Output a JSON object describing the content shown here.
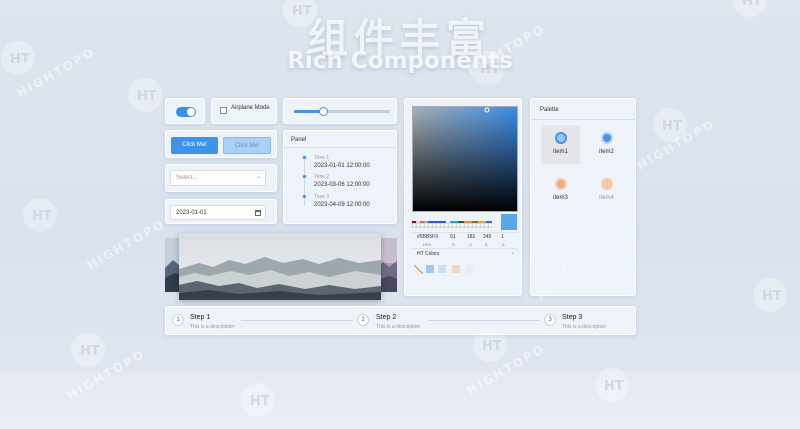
{
  "header": {
    "title_cn": "组件丰富",
    "title_en": "Rich Components"
  },
  "watermark": {
    "text": "HIGHTOPO",
    "logo_text": "HT"
  },
  "switch": {
    "on": true
  },
  "airplane_mode": {
    "label": "Airplane Mode",
    "checked": false
  },
  "slider": {
    "value": 0.3
  },
  "buttons": {
    "primary_label": "Click Me!",
    "secondary_label": "Click Me!"
  },
  "select": {
    "placeholder": "Select...",
    "chevron": "⌄"
  },
  "date_picker": {
    "value": "2023-01-01"
  },
  "panel": {
    "title": "Panel",
    "items": [
      {
        "label": "Time 1",
        "time": "2023-01-01 12:00:00"
      },
      {
        "label": "Time 2",
        "time": "2023-03-06 12:00:00"
      },
      {
        "label": "Time 3",
        "time": "2023-04-09 12:00:00"
      }
    ]
  },
  "color_picker": {
    "hex": "#5BB5F9",
    "r": "91",
    "g": "181",
    "b": "249",
    "a": "1",
    "hex_label": "HEX",
    "r_label": "R",
    "g_label": "G",
    "b_label": "B",
    "a_label": "A",
    "preset_label": "HT Colors",
    "chevron": "⌄",
    "swatches": [
      "#9fcaf0",
      "#c9def2",
      "#f0d7c8",
      "#e8ebf0",
      "#f2f3f5"
    ]
  },
  "palette": {
    "title": "Palette",
    "items": [
      {
        "label": "item1",
        "color": "#4a90e2",
        "selected": true
      },
      {
        "label": "item2",
        "color": "#4a90e2",
        "selected": false
      },
      {
        "label": "item3",
        "color": "#f0a070",
        "selected": false
      },
      {
        "label": "item4",
        "color": "#f4c7a8",
        "selected": false
      }
    ]
  },
  "steps": [
    {
      "number": "1",
      "title": "Step 1",
      "description": "This is a description"
    },
    {
      "number": "2",
      "title": "Step 2",
      "description": "This is a description"
    },
    {
      "number": "3",
      "title": "Step 3",
      "description": "This is a description"
    }
  ],
  "colors": {
    "accent": "#3d93ea",
    "card_bg": "#f0f4fa",
    "background": "#dde5ef"
  }
}
